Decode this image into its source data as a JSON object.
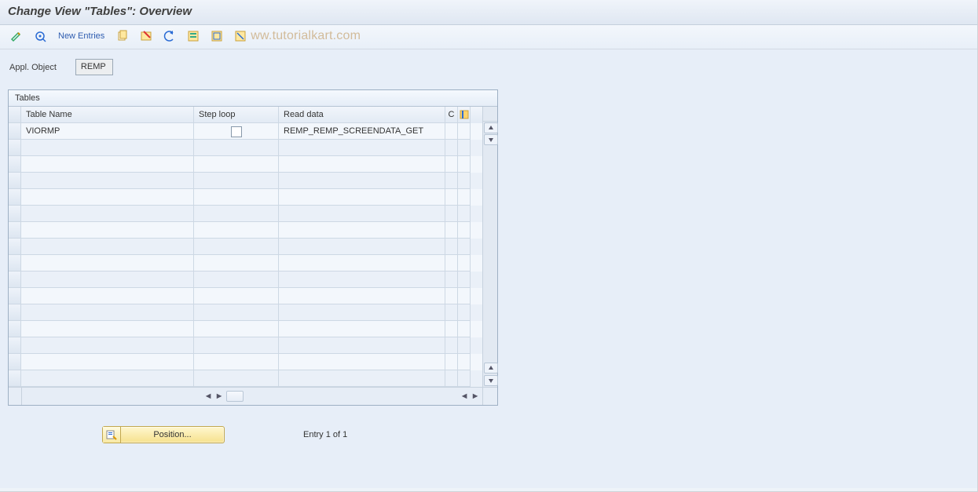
{
  "title": "Change View \"Tables\": Overview",
  "toolbar": {
    "new_entries_label": "New Entries",
    "watermark": "ww.tutorialkart.com"
  },
  "field": {
    "label": "Appl. Object",
    "value": "REMP"
  },
  "grid": {
    "title": "Tables",
    "columns": {
      "name": "Table Name",
      "step": "Step loop",
      "read": "Read data",
      "last": "C"
    },
    "rows": [
      {
        "name": "VIORMP",
        "step_checked": false,
        "read": "REMP_REMP_SCREENDATA_GET"
      }
    ],
    "empty_rows": 15
  },
  "footer": {
    "position_label": "Position...",
    "entry_text": "Entry 1 of 1"
  }
}
